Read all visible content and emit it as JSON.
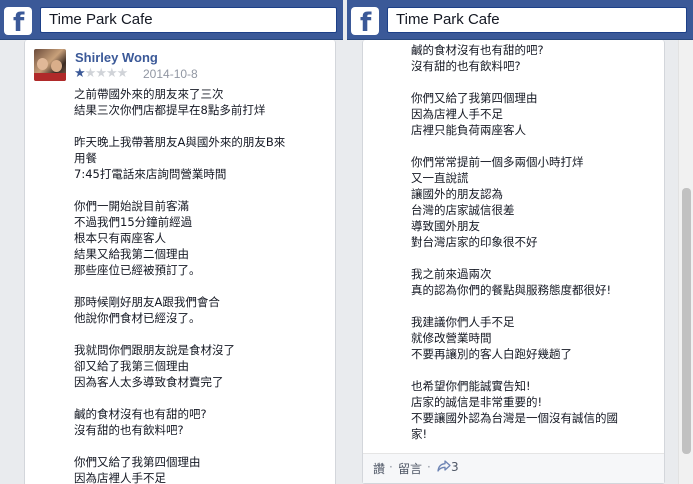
{
  "left_panel": {
    "search": "Time Park Cafe",
    "review": {
      "author": "Shirley Wong",
      "rating": 1,
      "max_rating": 5,
      "date": "2014-10-8",
      "text": "之前帶國外來的朋友來了三次\n結果三次你們店都提早在8點多前打烊\n\n昨天晚上我帶著朋友A與國外來的朋友B來\n用餐\n7:45打電話來店詢問營業時間\n\n你們一開始說目前客滿\n不過我們15分鐘前經過\n根本只有兩座客人\n結果又給我第二個理由\n那些座位已經被預訂了。\n\n那時候剛好朋友A跟我們會合\n他說你們食材已經沒了。\n\n我就問你們跟朋友說是食材沒了\n卻又給了我第三個理由\n因為客人太多導致食材賣完了\n\n鹹的食材沒有也有甜的吧?\n沒有甜的也有飲料吧?\n\n你們又給了我第四個理由\n因為店裡人手不足"
    }
  },
  "right_panel": {
    "search": "Time Park Cafe",
    "review": {
      "text": "鹹的食材沒有也有甜的吧?\n沒有甜的也有飲料吧?\n\n你們又給了我第四個理由\n因為店裡人手不足\n店裡只能負荷兩座客人\n\n你們常常提前一個多兩個小時打烊\n又一直說謊\n讓國外的朋友認為\n台灣的店家誠信很差\n導致國外朋友\n對台灣店家的印象很不好\n\n我之前來過兩次\n真的認為你們的餐點與服務態度都很好!\n\n我建議你們人手不足\n就修改營業時間\n不要再讓別的客人白跑好幾趟了\n\n也希望你們能誠實告知!\n店家的誠信是非常重要的!\n不要讓國外認為台灣是一個沒有誠信的國\n家!"
    },
    "actions": {
      "like": "讚",
      "comment": "留言",
      "share_count": "3"
    }
  },
  "colors": {
    "brand": "#3b5998",
    "text": "#141823",
    "meta": "#9197a3"
  },
  "icons": [
    "facebook-logo-icon",
    "star-icon",
    "share-icon"
  ]
}
